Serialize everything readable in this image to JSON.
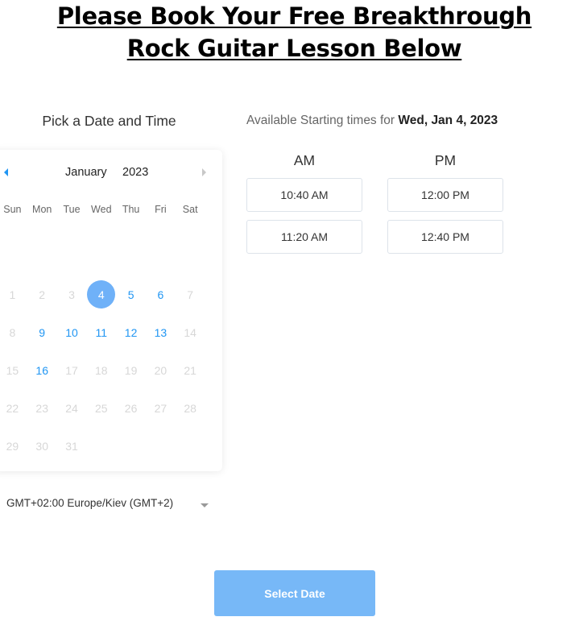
{
  "headline": {
    "line1": "Please Book Your Free Breakthrough",
    "line2": "Rock Guitar Lesson Below"
  },
  "picker": {
    "title": "Pick a Date and Time",
    "month": "January",
    "year": "2023",
    "prev_icon": "triangle-left",
    "next_icon": "triangle-right",
    "weekdays": [
      "Sun",
      "Mon",
      "Tue",
      "Wed",
      "Thu",
      "Fri",
      "Sat"
    ],
    "first_weekday_offset": 0,
    "days": [
      {
        "n": "1",
        "state": "disabled"
      },
      {
        "n": "2",
        "state": "disabled"
      },
      {
        "n": "3",
        "state": "disabled"
      },
      {
        "n": "4",
        "state": "selected"
      },
      {
        "n": "5",
        "state": "available"
      },
      {
        "n": "6",
        "state": "available"
      },
      {
        "n": "7",
        "state": "disabled"
      },
      {
        "n": "8",
        "state": "disabled"
      },
      {
        "n": "9",
        "state": "available"
      },
      {
        "n": "10",
        "state": "available"
      },
      {
        "n": "11",
        "state": "available"
      },
      {
        "n": "12",
        "state": "available"
      },
      {
        "n": "13",
        "state": "available"
      },
      {
        "n": "14",
        "state": "disabled"
      },
      {
        "n": "15",
        "state": "disabled"
      },
      {
        "n": "16",
        "state": "available"
      },
      {
        "n": "17",
        "state": "disabled"
      },
      {
        "n": "18",
        "state": "disabled"
      },
      {
        "n": "19",
        "state": "disabled"
      },
      {
        "n": "20",
        "state": "disabled"
      },
      {
        "n": "21",
        "state": "disabled"
      },
      {
        "n": "22",
        "state": "disabled"
      },
      {
        "n": "23",
        "state": "disabled"
      },
      {
        "n": "24",
        "state": "disabled"
      },
      {
        "n": "25",
        "state": "disabled"
      },
      {
        "n": "26",
        "state": "disabled"
      },
      {
        "n": "27",
        "state": "disabled"
      },
      {
        "n": "28",
        "state": "disabled"
      },
      {
        "n": "29",
        "state": "disabled"
      },
      {
        "n": "30",
        "state": "disabled"
      },
      {
        "n": "31",
        "state": "disabled"
      }
    ],
    "timezone": "GMT+02:00 Europe/Kiev (GMT+2)"
  },
  "times": {
    "prefix": "Available Starting times for ",
    "selected_date": "Wed, Jan 4, 2023",
    "am_label": "AM",
    "pm_label": "PM",
    "am_slots": [
      "10:40 AM",
      "11:20 AM"
    ],
    "pm_slots": [
      "12:00 PM",
      "12:40 PM"
    ]
  },
  "actions": {
    "select_date": "Select Date"
  },
  "colors": {
    "accent": "#2196f3",
    "selected_day": "#6fb1f8",
    "button": "#77b8f7",
    "disabled_day": "#d7d7d7"
  }
}
